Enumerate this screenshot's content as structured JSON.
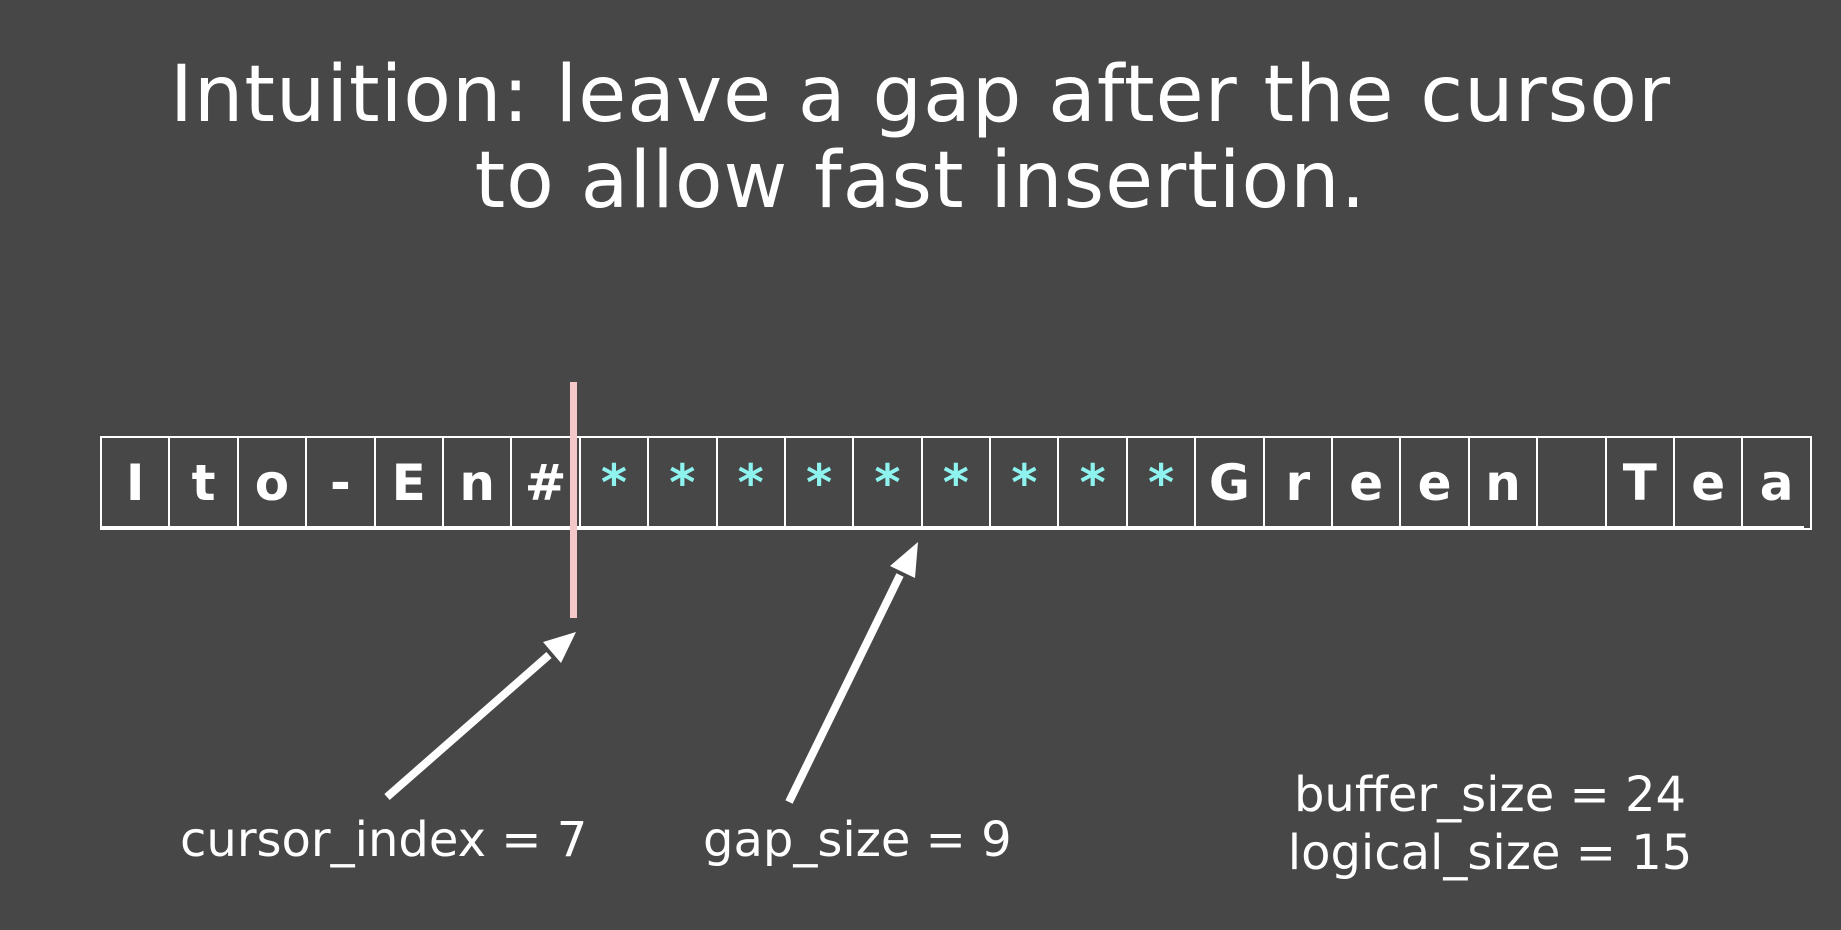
{
  "title": {
    "line1": "Intuition: leave a gap after the cursor",
    "line2": "to allow fast insertion."
  },
  "buffer": {
    "cells": [
      {
        "char": "I",
        "gap": false
      },
      {
        "char": "t",
        "gap": false
      },
      {
        "char": "o",
        "gap": false
      },
      {
        "char": "-",
        "gap": false
      },
      {
        "char": "E",
        "gap": false
      },
      {
        "char": "n",
        "gap": false
      },
      {
        "char": "#",
        "gap": false
      },
      {
        "char": "*",
        "gap": true
      },
      {
        "char": "*",
        "gap": true
      },
      {
        "char": "*",
        "gap": true
      },
      {
        "char": "*",
        "gap": true
      },
      {
        "char": "*",
        "gap": true
      },
      {
        "char": "*",
        "gap": true
      },
      {
        "char": "*",
        "gap": true
      },
      {
        "char": "*",
        "gap": true
      },
      {
        "char": "*",
        "gap": true
      },
      {
        "char": "G",
        "gap": false
      },
      {
        "char": "r",
        "gap": false
      },
      {
        "char": "e",
        "gap": false
      },
      {
        "char": "e",
        "gap": false
      },
      {
        "char": "n",
        "gap": false
      },
      {
        "char": "",
        "gap": false
      },
      {
        "char": "T",
        "gap": false
      },
      {
        "char": "e",
        "gap": false
      },
      {
        "char": "a",
        "gap": false
      }
    ],
    "gap_color": "#8ef2ee",
    "cursor_color": "#f4c8c8"
  },
  "labels": {
    "cursor_index": "cursor_index = 7",
    "gap_size": "gap_size = 9",
    "buffer_size": "buffer_size = 24",
    "logical_size": "logical_size = 15"
  }
}
